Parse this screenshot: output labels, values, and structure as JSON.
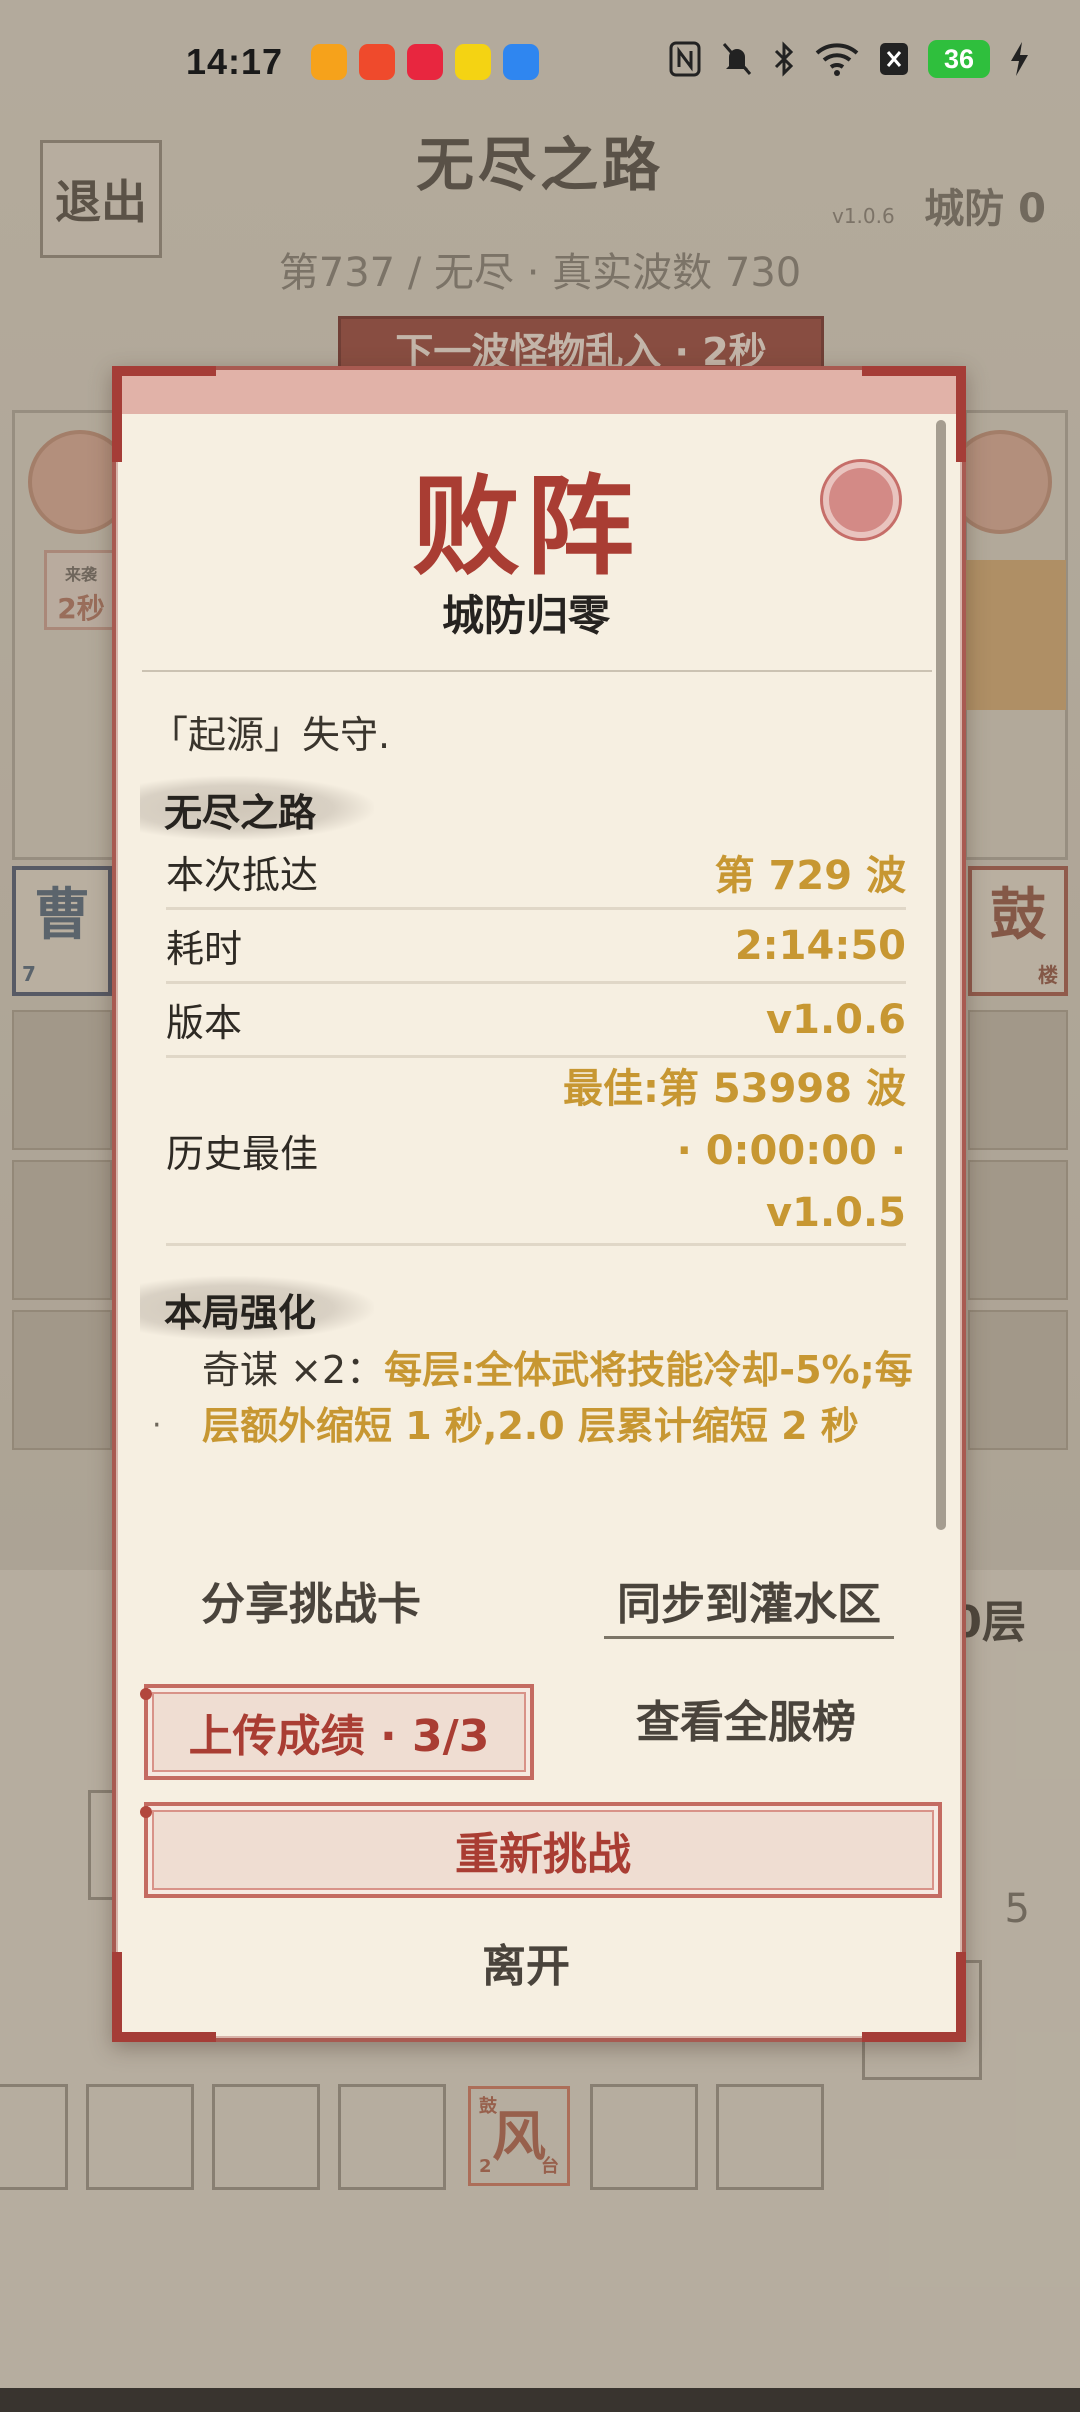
{
  "status_bar": {
    "time": "14:17",
    "battery": "36",
    "app_icons": [
      "video-app-icon",
      "taobao-app-icon",
      "music-app-icon",
      "qq-app-icon",
      "browser-app-icon"
    ],
    "system_icons": [
      "nfc-icon",
      "mute-icon",
      "bluetooth-icon",
      "wifi-icon",
      "sim-off-icon",
      "charging-icon"
    ]
  },
  "background": {
    "title": "无尽之路",
    "exit": "退出",
    "version": "v1.0.6",
    "defense": "城防 0",
    "wave_info": "第737 / 无尽 · 真实波数 730",
    "next_wave": "下一波怪物乱入 · 2秒",
    "hint_label": "来袭",
    "hint_value": "2秒",
    "left_card": "曹",
    "left_card_level": "7",
    "right_card": "鼓",
    "right_card_tag": "楼",
    "layer_suffix": "0层",
    "side_number": "5",
    "feng_tile": "风",
    "feng_level": "2",
    "feng_tag": "台",
    "feng_prefix": "鼓"
  },
  "modal": {
    "title": "败阵",
    "subtitle": "城防归零",
    "origin_text": "「起源」失守.",
    "section_endless": "无尽之路",
    "rows": {
      "reached_label": "本次抵达",
      "reached_value": "第 729 波",
      "time_label": "耗时",
      "time_value": "2:14:50",
      "version_label": "版本",
      "version_value": "v1.0.6",
      "best_label": "历史最佳",
      "best_value": "最佳:第 53998 波 · 0:00:00 · v1.0.5"
    },
    "section_buffs": "本局强化",
    "buff": {
      "bullet": "·",
      "name": "奇谋 ×2：",
      "effect": "每层:全体武将技能冷却-5%;每层额外缩短 1 秒,2.0 层累计缩短 2 秒"
    },
    "share": "分享挑战卡",
    "sync": "同步到灌水区",
    "upload": "上传成绩 · 3/3",
    "leaderboard": "查看全服榜",
    "retry": "重新挑战",
    "leave": "离开"
  },
  "colors": {
    "accent_red": "#a93d33",
    "value_gold": "#c79732",
    "panel_bg": "#f6efe1",
    "battery_green": "#2fbf3d"
  }
}
